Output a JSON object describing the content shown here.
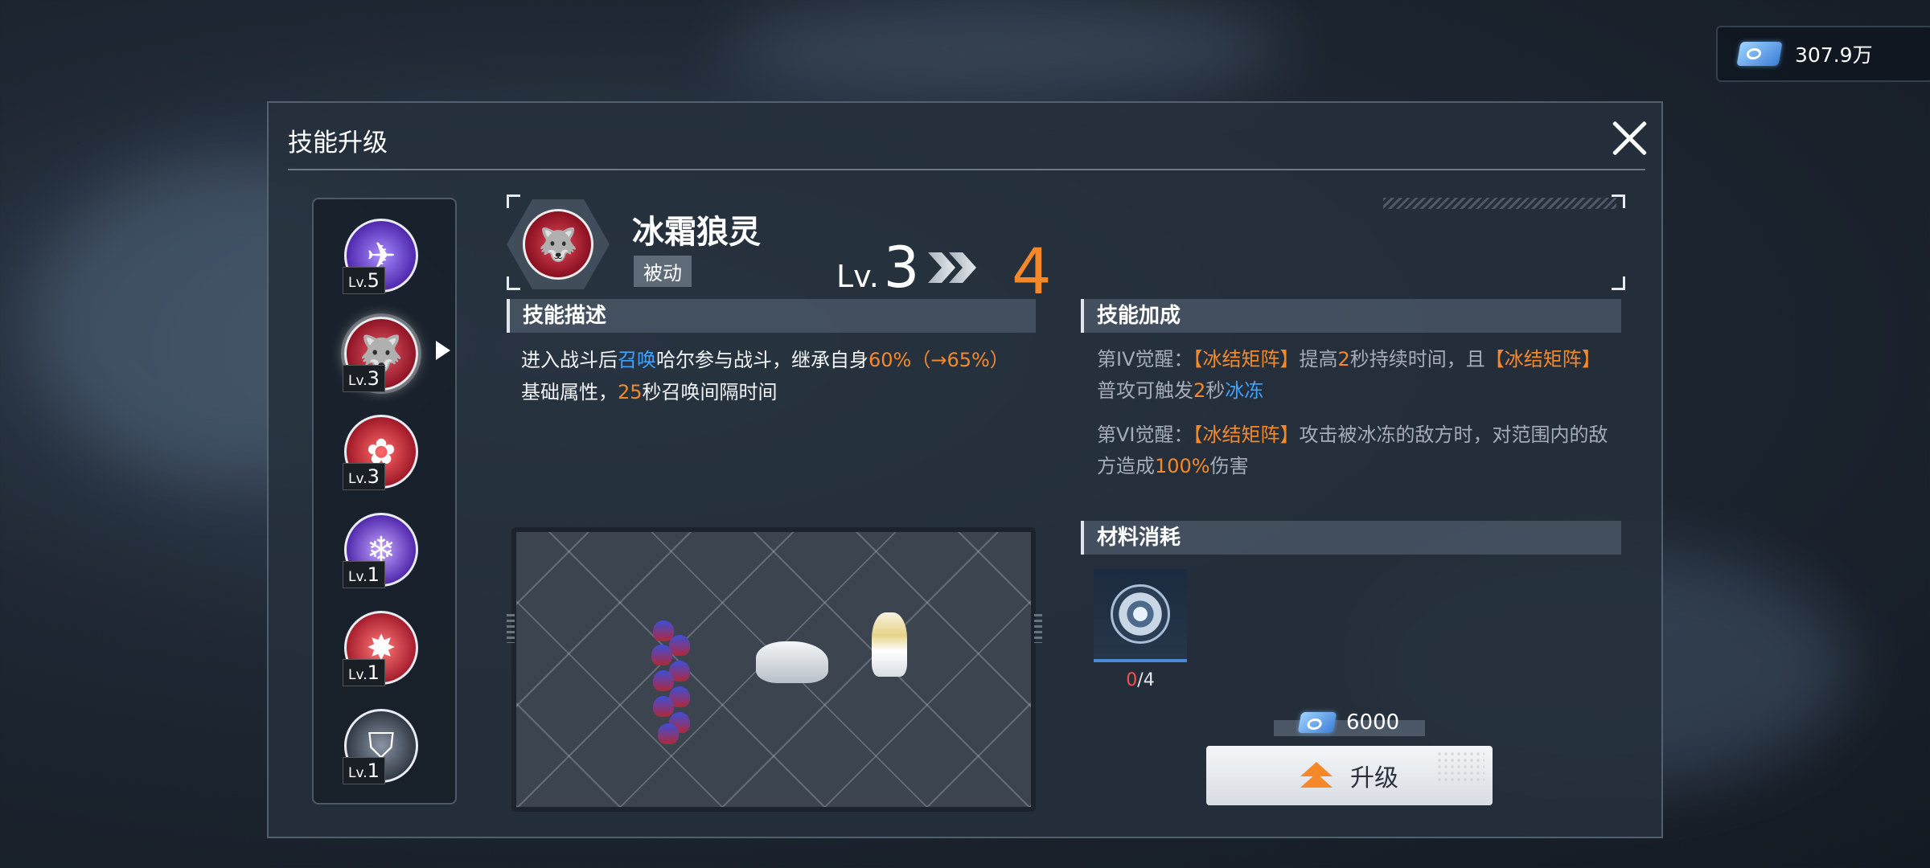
{
  "currency": {
    "icon": "ticket-icon",
    "amount": "307.9万"
  },
  "panel": {
    "title": "技能升级"
  },
  "skill_list": [
    {
      "lv_prefix": "Lv.",
      "lv": "5",
      "icon": "shark-jet-icon",
      "color": "#6a3fc4"
    },
    {
      "lv_prefix": "Lv.",
      "lv": "3",
      "icon": "frost-wolf-icon",
      "color": "#b0283a",
      "selected": true
    },
    {
      "lv_prefix": "Lv.",
      "lv": "3",
      "icon": "red-flower-icon",
      "color": "#c0283a"
    },
    {
      "lv_prefix": "Lv.",
      "lv": "1",
      "icon": "purple-snowflake-icon",
      "color": "#6a3fc4"
    },
    {
      "lv_prefix": "Lv.",
      "lv": "1",
      "icon": "red-burst-icon",
      "color": "#c0283a"
    },
    {
      "lv_prefix": "Lv.",
      "lv": "1",
      "icon": "shield-emblem-icon",
      "color": "#8890a0"
    }
  ],
  "skill": {
    "name": "冰霜狼灵",
    "type": "被动",
    "lv_prefix": "Lv.",
    "current_level": "3",
    "next_level": "4",
    "icon": "frost-wolf-icon"
  },
  "description": {
    "header": "技能描述",
    "t1": "进入战斗后",
    "t2": "召唤",
    "t3": "哈尔参与战斗，继承自身",
    "t4": "60%（→65%）",
    "t5": "基础属性，",
    "t6": "25",
    "t7": "秒召唤间隔时间"
  },
  "bonus": {
    "header": "技能加成",
    "a1": {
      "p1": "第IV觉醒：",
      "p2": "【冰结矩阵】",
      "p3": "提高",
      "p4": "2",
      "p5": "秒持续时间，且",
      "p6": "【冰结矩阵】",
      "p7": "普攻可触发",
      "p8": "2",
      "p9": "秒",
      "p10": "冰冻"
    },
    "a2": {
      "p1": "第VI觉醒：",
      "p2": "【冰结矩阵】",
      "p3": "攻击被冰冻的敌方时，对范围内的敌方造成",
      "p4": "100%",
      "p5": "伤害"
    }
  },
  "materials": {
    "header": "材料消耗",
    "item_icon": "gear-medal-icon",
    "have": "0",
    "sep": "/",
    "need": "4"
  },
  "cost": {
    "icon": "ticket-icon",
    "amount": "6000"
  },
  "upgrade_button": {
    "label": "升级",
    "icon": "upgrade-arrow-icon"
  }
}
